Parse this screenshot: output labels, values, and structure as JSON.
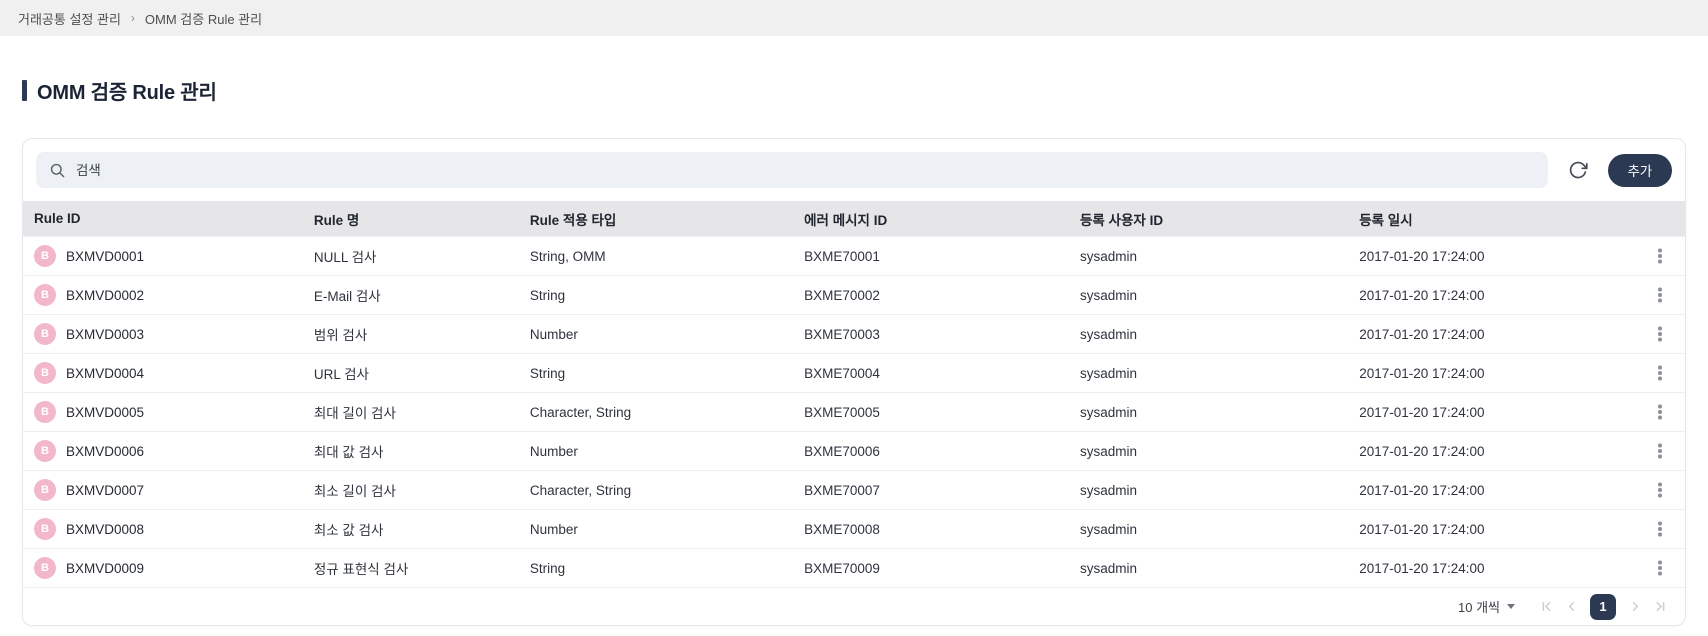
{
  "breadcrumb": {
    "items": [
      "거래공통 설정 관리",
      "OMM 검증 Rule 관리"
    ],
    "separator": "›"
  },
  "page": {
    "title": "OMM 검증 Rule 관리"
  },
  "toolbar": {
    "search_placeholder": "검색",
    "add_label": "추가"
  },
  "table": {
    "columns": [
      "Rule ID",
      "Rule 명",
      "Rule 적용 타입",
      "에러 메시지 ID",
      "등록 사용자 ID",
      "등록 일시"
    ],
    "badge_letter": "B",
    "rows": [
      {
        "rule_id": "BXMVD0001",
        "rule_name": "NULL 검사",
        "rule_type": "String, OMM",
        "error_message_id": "BXME70001",
        "reg_user_id": "sysadmin",
        "reg_datetime": "2017-01-20 17:24:00"
      },
      {
        "rule_id": "BXMVD0002",
        "rule_name": "E-Mail 검사",
        "rule_type": "String",
        "error_message_id": "BXME70002",
        "reg_user_id": "sysadmin",
        "reg_datetime": "2017-01-20 17:24:00"
      },
      {
        "rule_id": "BXMVD0003",
        "rule_name": "범위 검사",
        "rule_type": "Number",
        "error_message_id": "BXME70003",
        "reg_user_id": "sysadmin",
        "reg_datetime": "2017-01-20 17:24:00"
      },
      {
        "rule_id": "BXMVD0004",
        "rule_name": "URL 검사",
        "rule_type": "String",
        "error_message_id": "BXME70004",
        "reg_user_id": "sysadmin",
        "reg_datetime": "2017-01-20 17:24:00"
      },
      {
        "rule_id": "BXMVD0005",
        "rule_name": "최대 길이 검사",
        "rule_type": "Character, String",
        "error_message_id": "BXME70005",
        "reg_user_id": "sysadmin",
        "reg_datetime": "2017-01-20 17:24:00"
      },
      {
        "rule_id": "BXMVD0006",
        "rule_name": "최대 값 검사",
        "rule_type": "Number",
        "error_message_id": "BXME70006",
        "reg_user_id": "sysadmin",
        "reg_datetime": "2017-01-20 17:24:00"
      },
      {
        "rule_id": "BXMVD0007",
        "rule_name": "최소 길이 검사",
        "rule_type": "Character, String",
        "error_message_id": "BXME70007",
        "reg_user_id": "sysadmin",
        "reg_datetime": "2017-01-20 17:24:00"
      },
      {
        "rule_id": "BXMVD0008",
        "rule_name": "최소 값 검사",
        "rule_type": "Number",
        "error_message_id": "BXME70008",
        "reg_user_id": "sysadmin",
        "reg_datetime": "2017-01-20 17:24:00"
      },
      {
        "rule_id": "BXMVD0009",
        "rule_name": "정규 표현식 검사",
        "rule_type": "String",
        "error_message_id": "BXME70009",
        "reg_user_id": "sysadmin",
        "reg_datetime": "2017-01-20 17:24:00"
      }
    ]
  },
  "pagination": {
    "page_size_label": "10 개씩",
    "current_page": "1"
  },
  "colors": {
    "accent_navy": "#2b3a52",
    "badge_pink": "#f3b7ca",
    "header_gray": "#e6e6e9",
    "breadcrumb_gray": "#f0f0f1"
  }
}
